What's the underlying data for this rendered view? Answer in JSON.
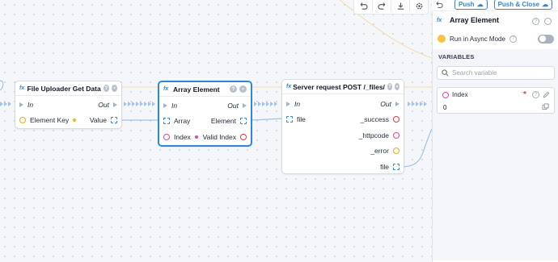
{
  "toolbar": {
    "icons": [
      "undo-icon",
      "redo-icon",
      "download-icon",
      "settings-icon"
    ]
  },
  "nodes": {
    "file_uploader": {
      "title": "File Uploader Get Data",
      "in": "In",
      "out": "Out",
      "input_label": "Element Key",
      "output_label": "Value"
    },
    "array_element": {
      "title": "Array Element",
      "in": "In",
      "out": "Out",
      "array_label": "Array",
      "element_label": "Element",
      "index_label": "Index",
      "valid_index_label": "Valid Index"
    },
    "server_request": {
      "title": "Server request POST /_files/",
      "in": "In",
      "out": "Out",
      "file_in_label": "file",
      "success_label": "_success",
      "httpcode_label": "_httpcode",
      "error_label": "_error",
      "file_out_label": "file"
    }
  },
  "panel": {
    "push_label": "Push",
    "push_close_label": "Push & Close",
    "title": "Array Element",
    "async_label": "Run in Async Mode",
    "variables_label": "VARIABLES",
    "search_placeholder": "Search variable",
    "variable": {
      "name": "Index",
      "value": "0"
    }
  },
  "colors": {
    "accent": "#2f87d9",
    "required": "#e23a3a",
    "index_port": "#e0489d"
  }
}
